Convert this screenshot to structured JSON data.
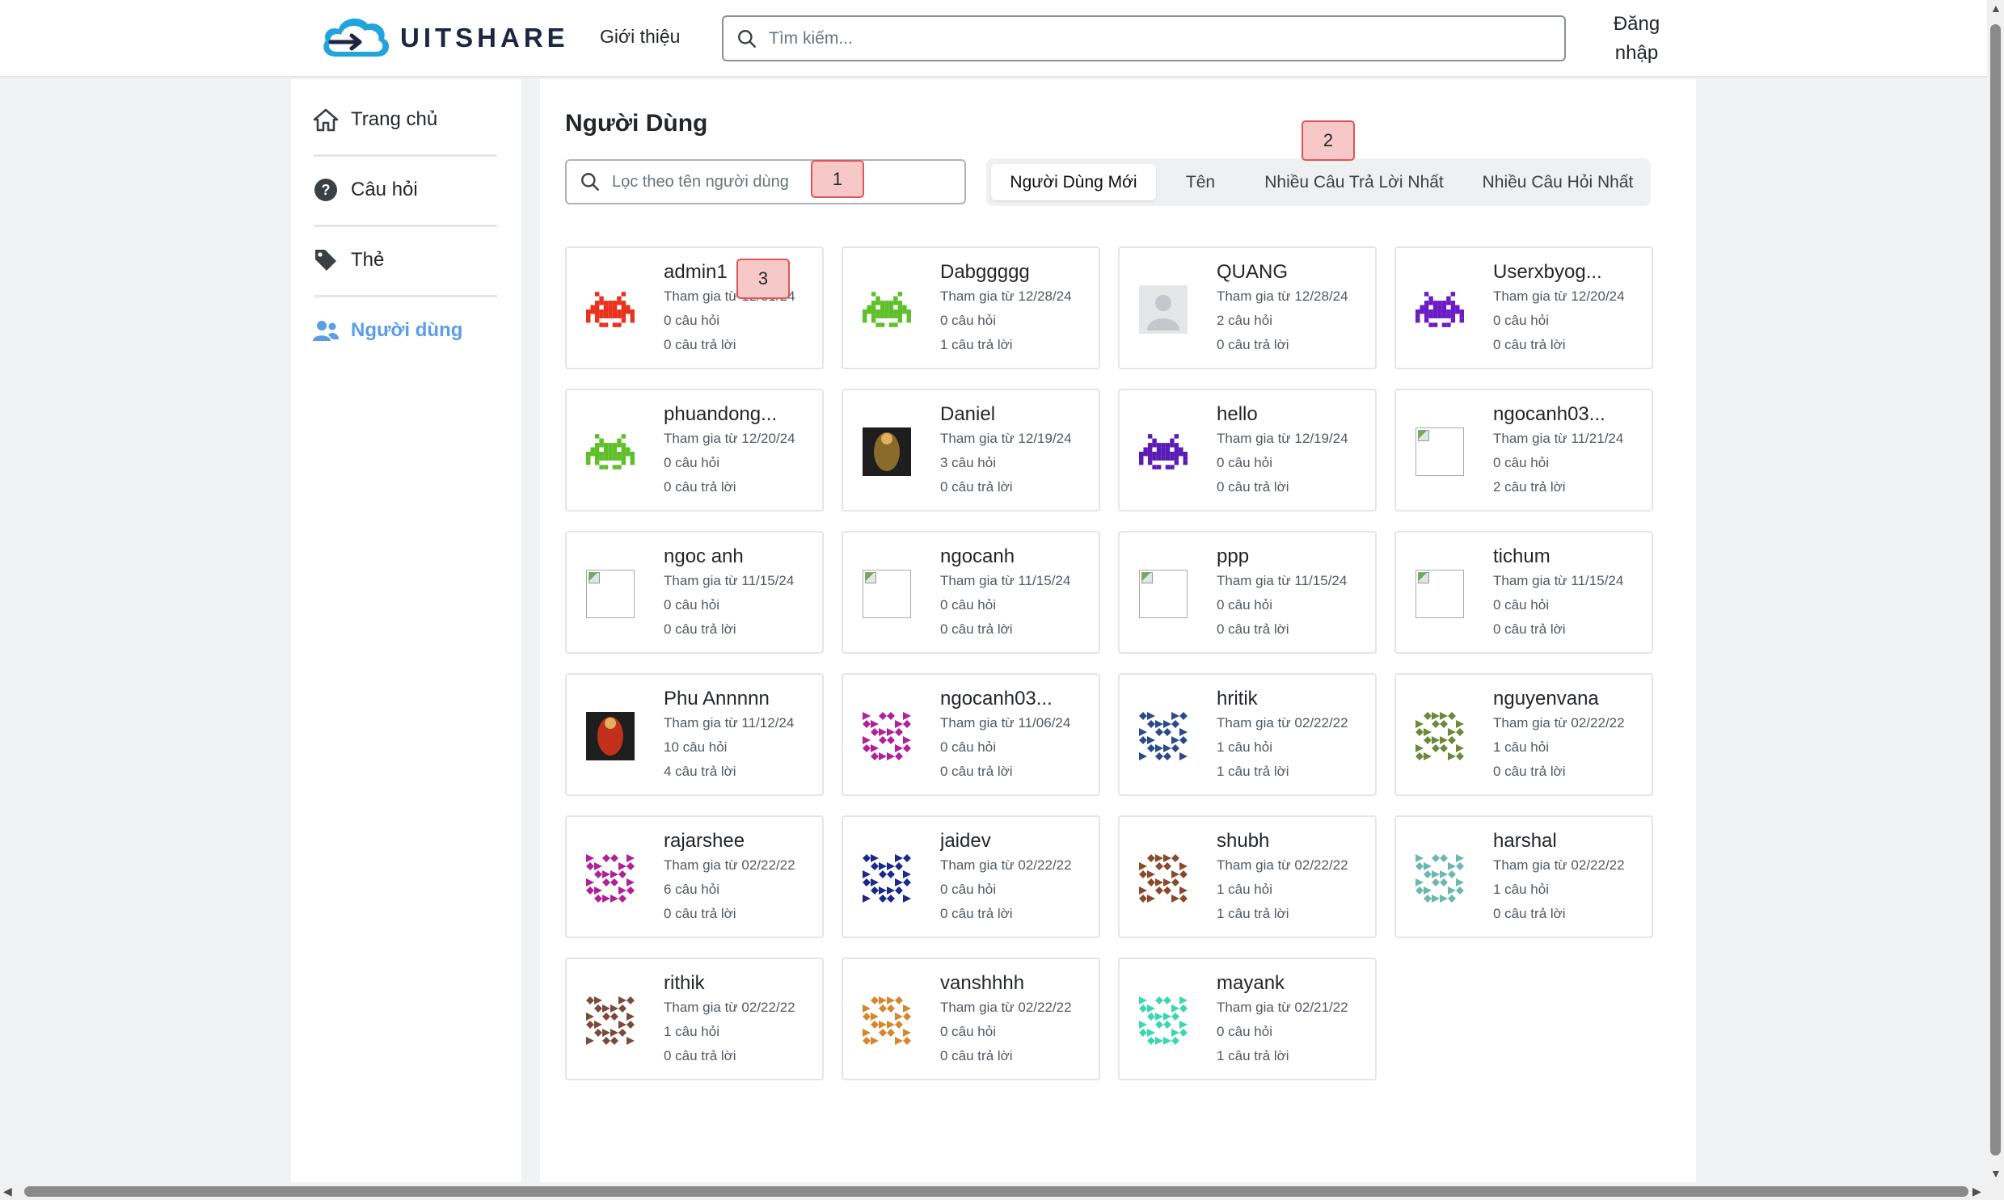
{
  "header": {
    "logo_text": "UITSHARE",
    "nav_about": "Giới thiệu",
    "search_placeholder": "Tìm kiếm...",
    "login": "Đăng nhập"
  },
  "sidebar": {
    "items": [
      {
        "label": "Trang chủ",
        "icon": "home-icon"
      },
      {
        "label": "Câu hỏi",
        "icon": "question-icon"
      },
      {
        "label": "Thẻ",
        "icon": "tag-icon"
      },
      {
        "label": "Người dùng",
        "icon": "users-icon",
        "active": true
      }
    ]
  },
  "main": {
    "title": "Người Dùng",
    "filter_placeholder": "Lọc theo tên người dùng",
    "tabs": [
      {
        "label": "Người Dùng Mới",
        "active": true
      },
      {
        "label": "Tên"
      },
      {
        "label": "Nhiều Câu Trả Lời Nhất"
      },
      {
        "label": "Nhiều Câu Hỏi Nhất"
      }
    ],
    "badges": [
      "1",
      "2",
      "3"
    ]
  },
  "users": [
    {
      "name": "admin1",
      "joined": "Tham gia từ 12/31/24",
      "questions": "0 câu hỏi",
      "answers": "0 câu trả lời",
      "avatar": "pixel",
      "color": "#e8321b"
    },
    {
      "name": "Dabggggg",
      "joined": "Tham gia từ 12/28/24",
      "questions": "0 câu hỏi",
      "answers": "1 câu trả lời",
      "avatar": "pixel",
      "color": "#5fbf2a"
    },
    {
      "name": "QUANG",
      "joined": "Tham gia từ 12/28/24",
      "questions": "2 câu hỏi",
      "answers": "0 câu trả lời",
      "avatar": "default",
      "color": "#c4c8cc"
    },
    {
      "name": "Userxbyog...",
      "joined": "Tham gia từ 12/20/24",
      "questions": "0 câu hỏi",
      "answers": "0 câu trả lời",
      "avatar": "pixel",
      "color": "#6a1bc4"
    },
    {
      "name": "phuandong...",
      "joined": "Tham gia từ 12/20/24",
      "questions": "0 câu hỏi",
      "answers": "0 câu trả lời",
      "avatar": "pixel",
      "color": "#5fbf2a"
    },
    {
      "name": "Daniel",
      "joined": "Tham gia từ 12/19/24",
      "questions": "3 câu hỏi",
      "answers": "0 câu trả lời",
      "avatar": "photo",
      "color": "#8a6a2a"
    },
    {
      "name": "hello",
      "joined": "Tham gia từ 12/19/24",
      "questions": "0 câu hỏi",
      "answers": "0 câu trả lời",
      "avatar": "pixel",
      "color": "#5a1bb4"
    },
    {
      "name": "ngocanh03...",
      "joined": "Tham gia từ 11/21/24",
      "questions": "0 câu hỏi",
      "answers": "2 câu trả lời",
      "avatar": "broken",
      "color": "#ffffff"
    },
    {
      "name": "ngoc anh",
      "joined": "Tham gia từ 11/15/24",
      "questions": "0 câu hỏi",
      "answers": "0 câu trả lời",
      "avatar": "broken",
      "color": "#ffffff"
    },
    {
      "name": "ngocanh",
      "joined": "Tham gia từ 11/15/24",
      "questions": "0 câu hỏi",
      "answers": "0 câu trả lời",
      "avatar": "broken",
      "color": "#ffffff"
    },
    {
      "name": "ppp",
      "joined": "Tham gia từ 11/15/24",
      "questions": "0 câu hỏi",
      "answers": "0 câu trả lời",
      "avatar": "broken",
      "color": "#ffffff"
    },
    {
      "name": "tichum",
      "joined": "Tham gia từ 11/15/24",
      "questions": "0 câu hỏi",
      "answers": "0 câu trả lời",
      "avatar": "broken",
      "color": "#ffffff"
    },
    {
      "name": "Phu Annnnn",
      "joined": "Tham gia từ 11/12/24",
      "questions": "10 câu hỏi",
      "answers": "4 câu trả lời",
      "avatar": "photo",
      "color": "#c0301a"
    },
    {
      "name": "ngocanh03...",
      "joined": "Tham gia từ 11/06/24",
      "questions": "0 câu hỏi",
      "answers": "0 câu trả lời",
      "avatar": "identicon",
      "color": "#b0209a"
    },
    {
      "name": "hritik",
      "joined": "Tham gia từ 02/22/22",
      "questions": "1 câu hỏi",
      "answers": "1 câu trả lời",
      "avatar": "identicon",
      "color": "#2a4a8a"
    },
    {
      "name": "nguyenvana",
      "joined": "Tham gia từ 02/22/22",
      "questions": "1 câu hỏi",
      "answers": "0 câu trả lời",
      "avatar": "identicon",
      "color": "#6a8a3a"
    },
    {
      "name": "rajarshee",
      "joined": "Tham gia từ 02/22/22",
      "questions": "6 câu hỏi",
      "answers": "0 câu trả lời",
      "avatar": "identicon",
      "color": "#b0209a"
    },
    {
      "name": "jaidev",
      "joined": "Tham gia từ 02/22/22",
      "questions": "0 câu hỏi",
      "answers": "0 câu trả lời",
      "avatar": "identicon",
      "color": "#1a2a8a"
    },
    {
      "name": "shubh",
      "joined": "Tham gia từ 02/22/22",
      "questions": "1 câu hỏi",
      "answers": "1 câu trả lời",
      "avatar": "identicon",
      "color": "#8a4a2a"
    },
    {
      "name": "harshal",
      "joined": "Tham gia từ 02/22/22",
      "questions": "1 câu hỏi",
      "answers": "0 câu trả lời",
      "avatar": "identicon",
      "color": "#6ab8b0"
    },
    {
      "name": "rithik",
      "joined": "Tham gia từ 02/22/22",
      "questions": "1 câu hỏi",
      "answers": "0 câu trả lời",
      "avatar": "identicon",
      "color": "#7a4a3a"
    },
    {
      "name": "vanshhhh",
      "joined": "Tham gia từ 02/22/22",
      "questions": "0 câu hỏi",
      "answers": "0 câu trả lời",
      "avatar": "identicon",
      "color": "#d8862a"
    },
    {
      "name": "mayank",
      "joined": "Tham gia từ 02/21/22",
      "questions": "0 câu hỏi",
      "answers": "1 câu trả lời",
      "avatar": "identicon",
      "color": "#3ad8b0"
    }
  ]
}
